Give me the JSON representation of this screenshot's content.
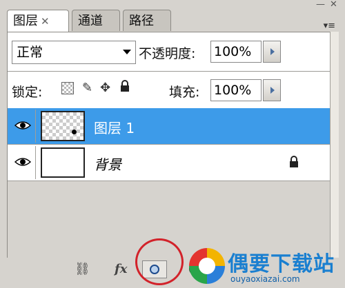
{
  "window": {
    "minimize_label": "—",
    "close_label": "✕"
  },
  "tabs": [
    {
      "label": "图层",
      "close": "✕",
      "active": true
    },
    {
      "label": "通道",
      "active": false
    },
    {
      "label": "路径",
      "active": false
    }
  ],
  "panel_menu_label": "▾≡",
  "blend_mode": {
    "value": "正常"
  },
  "opacity": {
    "label": "不透明度:",
    "value": "100%"
  },
  "lock": {
    "label": "锁定:"
  },
  "fill": {
    "label": "填充:",
    "value": "100%"
  },
  "layers": [
    {
      "name": "图层 1",
      "selected": true,
      "visible": true
    },
    {
      "name": "背景",
      "selected": false,
      "visible": true,
      "locked": true
    }
  ],
  "bottom_icons": [
    "link-layers-icon",
    "layer-style-fx-icon",
    "add-mask-icon",
    "adjustment-layer-icon",
    "new-group-icon",
    "new-layer-icon",
    "delete-icon"
  ],
  "fx_label": "fx",
  "watermark": {
    "title": "偶要下载站",
    "url": "ouyaoxiazai.com"
  }
}
